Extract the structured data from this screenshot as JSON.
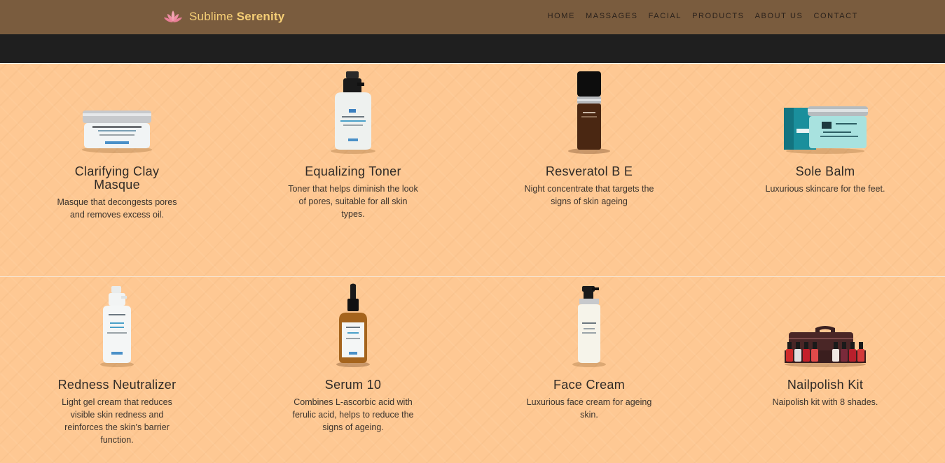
{
  "brand": {
    "name_part1": "Sublime",
    "name_part2": "Serenity",
    "logo_icon": "lotus-icon",
    "accent_color": "#f6cf76"
  },
  "nav": {
    "items": [
      {
        "label": "HOME"
      },
      {
        "label": "MASSAGES"
      },
      {
        "label": "FACIAL"
      },
      {
        "label": "PRODUCTS"
      },
      {
        "label": "ABOUT US"
      },
      {
        "label": "CONTACT"
      }
    ]
  },
  "colors": {
    "header_bg": "#7a5c3e",
    "dark_band": "#1f1f1f",
    "page_bg": "#fec893"
  },
  "products": [
    {
      "title": "Clarifying Clay Masque",
      "description": "Masque that decongests pores and removes excess oil.",
      "image": "clay-masque-jar"
    },
    {
      "title": "Equalizing Toner",
      "description": "Toner that helps diminish the look of pores, suitable for all skin types.",
      "image": "toner-spray-bottle"
    },
    {
      "title": "Resveratol B E",
      "description": "Night concentrate that targets the signs of skin ageing",
      "image": "serum-pump-bottle"
    },
    {
      "title": "Sole Balm",
      "description": "Luxurious skincare for the feet.",
      "image": "balm-jar-with-box"
    },
    {
      "title": "Redness Neutralizer",
      "description": "Light gel cream that reduces visible skin redness and reinforces the skin's barrier function.",
      "image": "spray-bottle"
    },
    {
      "title": "Serum 10",
      "description": "Combines L-ascorbic acid with ferulic acid, helps to reduce the signs of ageing.",
      "image": "dropper-bottle"
    },
    {
      "title": "Face Cream",
      "description": "Luxurious face cream for ageing skin.",
      "image": "pump-bottle"
    },
    {
      "title": "Nailpolish Kit",
      "description": "Naipolish kit with 8 shades.",
      "image": "nailpolish-case"
    }
  ]
}
